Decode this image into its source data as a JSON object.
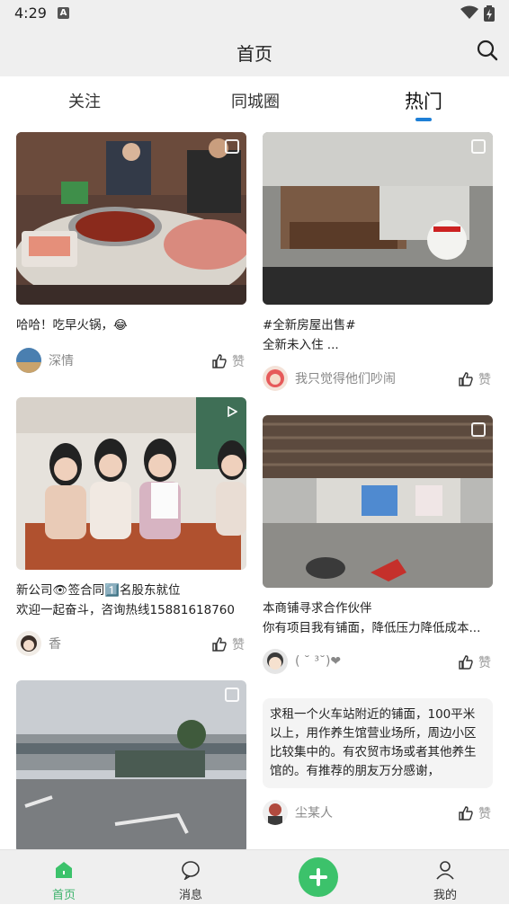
{
  "status_bar": {
    "time": "4:29",
    "notification_icon": "a-icon"
  },
  "header": {
    "title": "首页",
    "search_icon": "search-icon"
  },
  "tabs": [
    {
      "label": "关注",
      "active": false
    },
    {
      "label": "同城圈",
      "active": false
    },
    {
      "label": "热门",
      "active": true
    }
  ],
  "feed": {
    "left": [
      {
        "caption_lines": [
          "哈哈！吃早火锅，"
        ],
        "emoji": "😂",
        "author": "深情",
        "like_label": "赞",
        "media": "image"
      },
      {
        "caption_lines": [
          "新公司👁签合同1️⃣名股东就位",
          " 欢迎一起奋斗，咨询热线15881618760"
        ],
        "author": "香",
        "like_label": "赞",
        "media": "video"
      },
      {
        "caption_lines": [],
        "author": "",
        "like_label": "",
        "media": "image"
      }
    ],
    "right": [
      {
        "caption_lines": [
          "#全新房屋出售#",
          "全新未入住 ..."
        ],
        "author": "我只觉得他们吵闹",
        "like_label": "赞",
        "media": "image"
      },
      {
        "caption_lines": [
          "本商铺寻求合作伙伴",
          "你有项目我有铺面，降低压力降低成本..."
        ],
        "author": "( ˘ ³˘)❤",
        "like_label": "赞",
        "media": "video"
      },
      {
        "text_only": "求租一个火车站附近的铺面，100平米以上，用作养生馆营业场所，周边小区比较集中的。有农贸市场或者其他养生馆的。有推荐的朋友万分感谢，",
        "author": "尘某人",
        "like_label": "赞"
      }
    ]
  },
  "bottom_nav": [
    {
      "label": "首页",
      "icon": "home-icon",
      "active": true
    },
    {
      "label": "消息",
      "icon": "message-icon",
      "active": false
    },
    {
      "label": "",
      "icon": "plus-icon",
      "active": false
    },
    {
      "label": "我的",
      "icon": "profile-icon",
      "active": false
    }
  ],
  "colors": {
    "accent_blue": "#1e7fd6",
    "accent_green": "#3cc26b",
    "bar_bg": "#efefef"
  }
}
